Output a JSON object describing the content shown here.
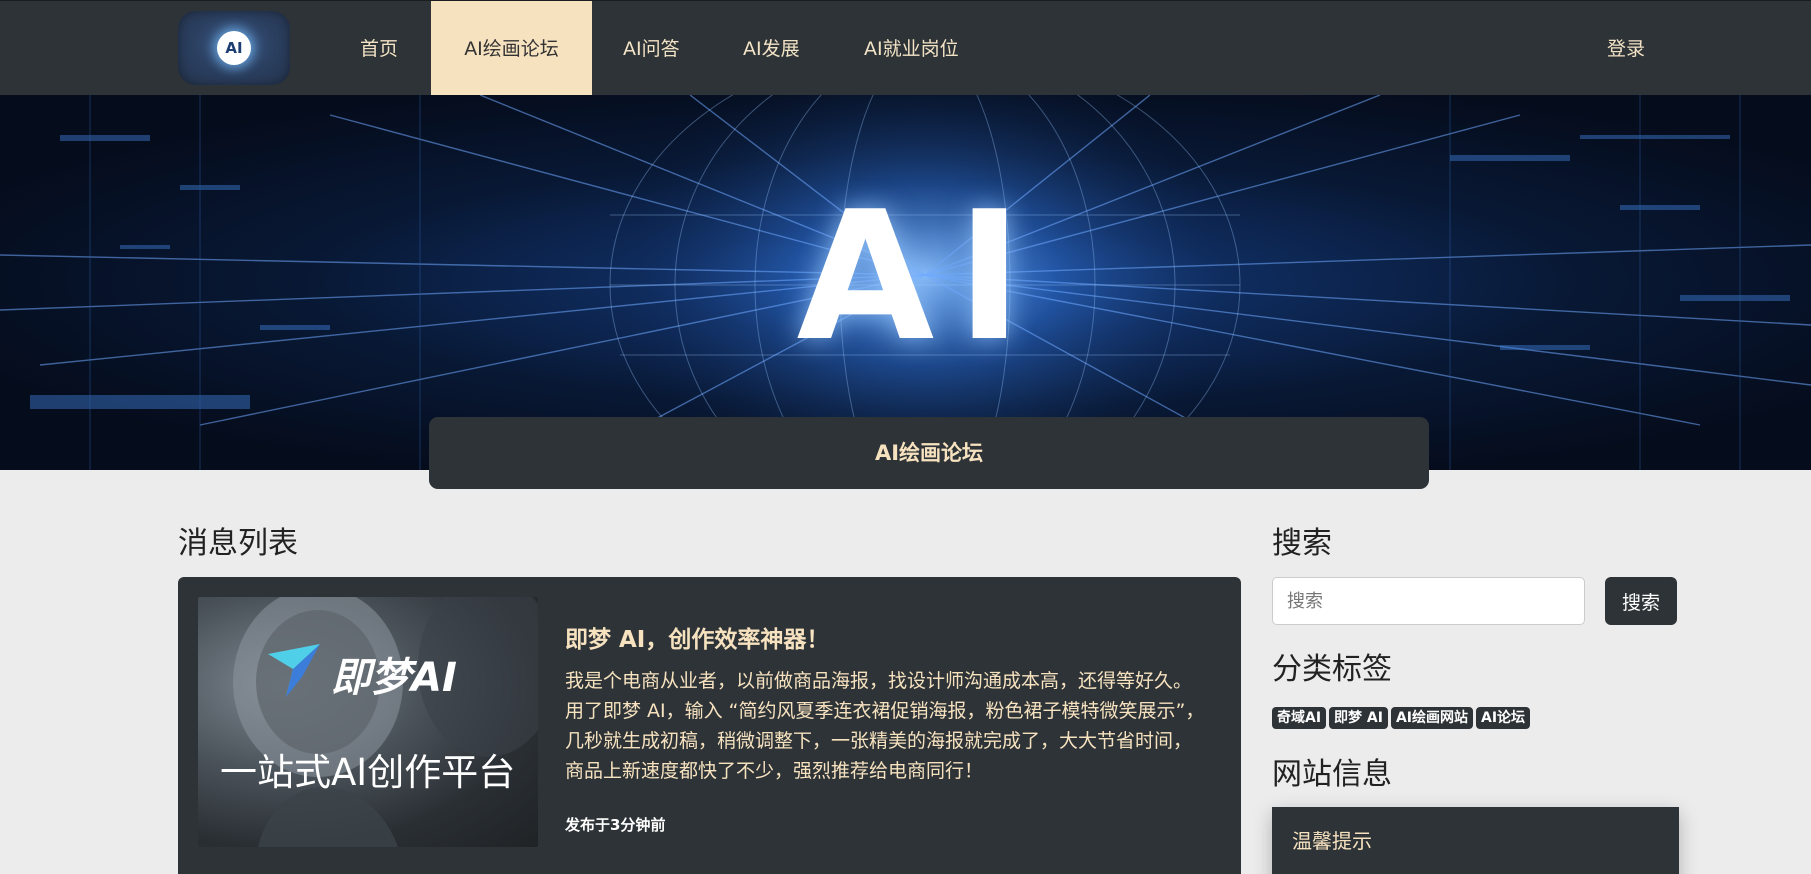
{
  "nav": {
    "logo_text": "AI",
    "items": [
      {
        "label": "首页"
      },
      {
        "label": "AI绘画论坛",
        "active": true
      },
      {
        "label": "AI问答"
      },
      {
        "label": "AI发展"
      },
      {
        "label": "AI就业岗位"
      }
    ],
    "login_label": "登录"
  },
  "hero": {
    "big_text": "AI"
  },
  "banner": {
    "title": "AI绘画论坛"
  },
  "main": {
    "list_title": "消息列表",
    "post": {
      "image_logo_text": "即梦AI",
      "image_tagline": "一站式AI创作平台",
      "title": "即梦 AI，创作效率神器！",
      "excerpt": "我是个电商从业者，以前做商品海报，找设计师沟通成本高，还得等好久。用了即梦 AI，输入 “简约风夏季连衣裙促销海报，粉色裙子模特微笑展示”，几秒就生成初稿，稍微调整下，一张精美的海报就完成了，大大节省时间，商品上新速度都快了不少，强烈推荐给电商同行！",
      "meta": "发布于3分钟前"
    }
  },
  "sidebar": {
    "search_title": "搜索",
    "search_placeholder": "搜索",
    "search_button": "搜索",
    "tags_title": "分类标签",
    "tags": [
      "奇域AI",
      "即梦 AI",
      "AI绘画网站",
      "AI论坛"
    ],
    "info_title": "网站信息",
    "info_card_title": "温馨提示"
  },
  "colors": {
    "nav_bg": "#2d3336",
    "accent_cream": "#f7e2c0",
    "page_bg": "#ececec"
  }
}
